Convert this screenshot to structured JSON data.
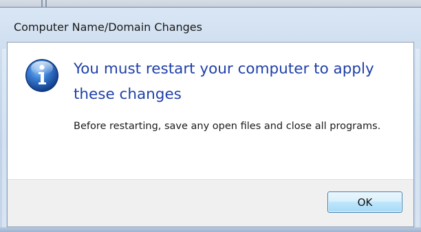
{
  "window": {
    "title": "Computer Name/Domain Changes"
  },
  "message": {
    "icon": "info-icon",
    "headline": "You must restart your computer to apply these changes",
    "body": "Before restarting, save any open files and close all programs."
  },
  "buttons": {
    "ok_label": "OK"
  },
  "colors": {
    "headline": "#1e3fa8",
    "button_bar": "#f0f0f0",
    "icon_blue": "#1f5fb8"
  }
}
